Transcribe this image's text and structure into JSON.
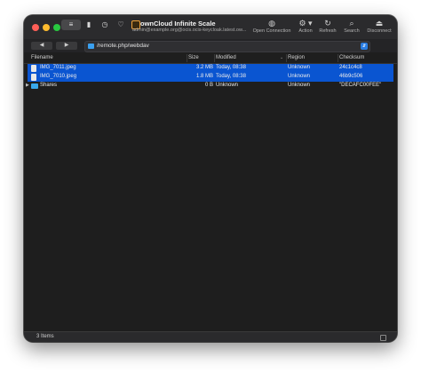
{
  "window": {
    "title": "ownCloud Infinite Scale",
    "subtitle": "admin@example.org@ocis.ocis-keycloak.latest.ow..."
  },
  "toolbar": {
    "segmented": "≡",
    "buttons": [
      {
        "label": "Open Connection",
        "icon": "globe-icon",
        "glyph": "◍"
      },
      {
        "label": "Action",
        "icon": "gear-icon",
        "glyph": "⚙ ▾"
      },
      {
        "label": "Refresh",
        "icon": "refresh-icon",
        "glyph": "↻"
      },
      {
        "label": "Search",
        "icon": "search-icon",
        "glyph": "⌕"
      },
      {
        "label": "Disconnect",
        "icon": "eject-icon",
        "glyph": "⏏"
      }
    ]
  },
  "pathbar": {
    "back": "◀",
    "forward": "▶",
    "path": "/remote.php/webdav",
    "stepper": "⇵"
  },
  "table": {
    "columns": [
      "Filename",
      "Size",
      "Modified",
      "Region",
      "Checksum"
    ],
    "sort_indicator": "⌄",
    "rows": [
      {
        "filename": "IMG_7011.jpeg",
        "size": "3.2 MB",
        "modified": "Today, 08:38",
        "region": "Unknown",
        "checksum": "24c1c4c8",
        "selected": true,
        "type": "file"
      },
      {
        "filename": "IMG_7010.jpeg",
        "size": "1.8 MB",
        "modified": "Today, 08:38",
        "region": "Unknown",
        "checksum": "46b9c506",
        "selected": true,
        "type": "file"
      },
      {
        "filename": "Shares",
        "size": "0 B",
        "modified": "Unknown",
        "region": "Unknown",
        "checksum": "\"DECAFC00FEE\"",
        "selected": false,
        "type": "folder"
      }
    ]
  },
  "status": {
    "items": "3 Items"
  },
  "colors": {
    "selection": "#0a55d1",
    "folder": "#39a7ea",
    "background": "#1e1e1e"
  }
}
